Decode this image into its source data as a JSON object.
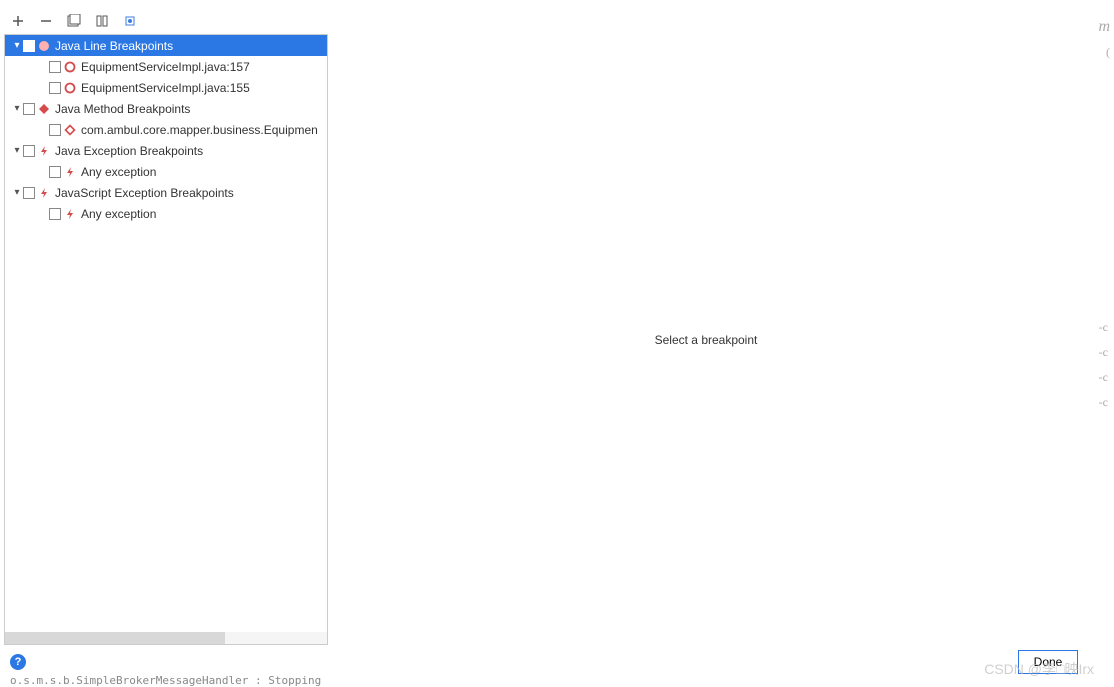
{
  "toolbar": {
    "add": "+",
    "remove": "−"
  },
  "tree": {
    "groups": [
      {
        "id": "java-line",
        "label": "Java Line Breakpoints",
        "icon": "circle-solid-red",
        "selected": true,
        "expanded": true,
        "children": [
          {
            "id": "eq157",
            "label": "EquipmentServiceImpl.java:157",
            "icon": "circle-outline-red"
          },
          {
            "id": "eq155",
            "label": "EquipmentServiceImpl.java:155",
            "icon": "circle-outline-red"
          }
        ]
      },
      {
        "id": "java-method",
        "label": "Java Method Breakpoints",
        "icon": "diamond-solid-red",
        "expanded": true,
        "children": [
          {
            "id": "mapper",
            "label": "com.ambul.core.mapper.business.Equipmen",
            "icon": "diamond-outline-red"
          }
        ]
      },
      {
        "id": "java-exc",
        "label": "Java Exception Breakpoints",
        "icon": "lightning-red",
        "expanded": true,
        "children": [
          {
            "id": "anyexc1",
            "label": "Any exception",
            "icon": "lightning-red"
          }
        ]
      },
      {
        "id": "js-exc",
        "label": "JavaScript Exception Breakpoints",
        "icon": "lightning-red",
        "expanded": true,
        "children": [
          {
            "id": "anyexc2",
            "label": "Any exception",
            "icon": "lightning-red"
          }
        ]
      }
    ]
  },
  "detail": {
    "placeholder": "Select a breakpoint"
  },
  "footer": {
    "done": "Done"
  },
  "watermark": "CSDN @李□映Irx",
  "right_edge": {
    "m": "m",
    "paren": "(",
    "c1": "-c",
    "c2": "-c",
    "c3": "-c",
    "c4": "-c"
  },
  "bottom_strip": "o.s.m.s.b.SimpleBrokerMessageHandler : Stopping"
}
